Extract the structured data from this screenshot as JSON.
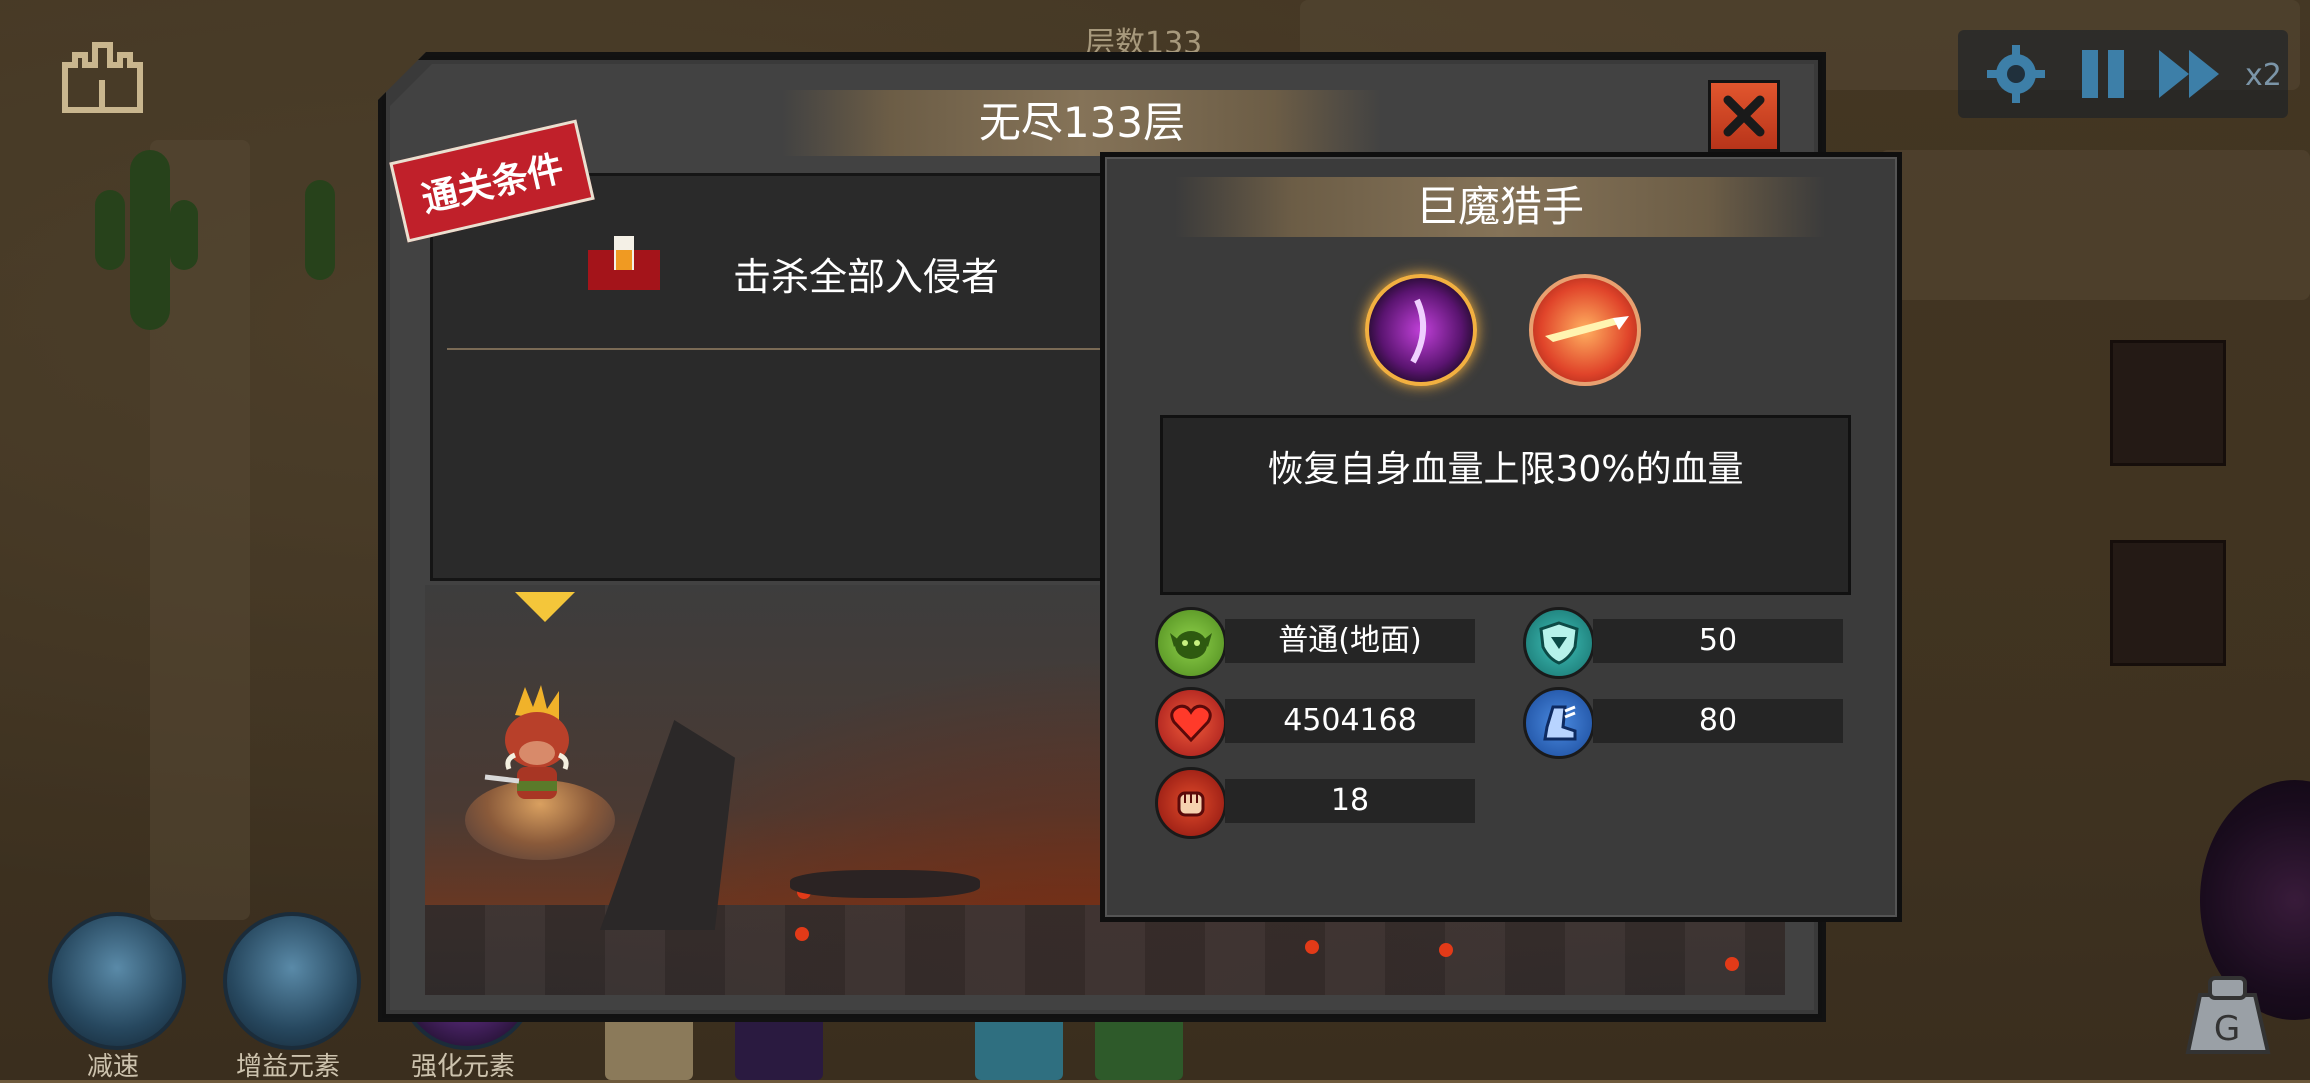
{
  "hud": {
    "floor_label": "层数133",
    "speed_label": "x2"
  },
  "dialog": {
    "title": "无尽133层",
    "ribbon_label": "通关条件",
    "condition_text": "击杀全部入侵者"
  },
  "enemy": {
    "name": "巨魔猎手",
    "skills": [
      "purple-slash-skill-icon",
      "fire-arrow-skill-icon"
    ],
    "skill_description": "恢复自身血量上限30%的血量",
    "stats": {
      "type": "普通(地面)",
      "armor": "50",
      "hp": "4504168",
      "speed": "80",
      "attack": "18"
    }
  },
  "skill_bar": [
    {
      "label": "减速"
    },
    {
      "label": "增益元素"
    },
    {
      "label": "强化元素"
    }
  ],
  "colors": {
    "close_button": "#c8401f",
    "ribbon": "#c0202a",
    "stat_type": "#6aa52a",
    "stat_armor": "#1f8a8a",
    "stat_hp": "#c4231d",
    "stat_speed": "#2a63b8",
    "stat_attack": "#b3261c"
  }
}
